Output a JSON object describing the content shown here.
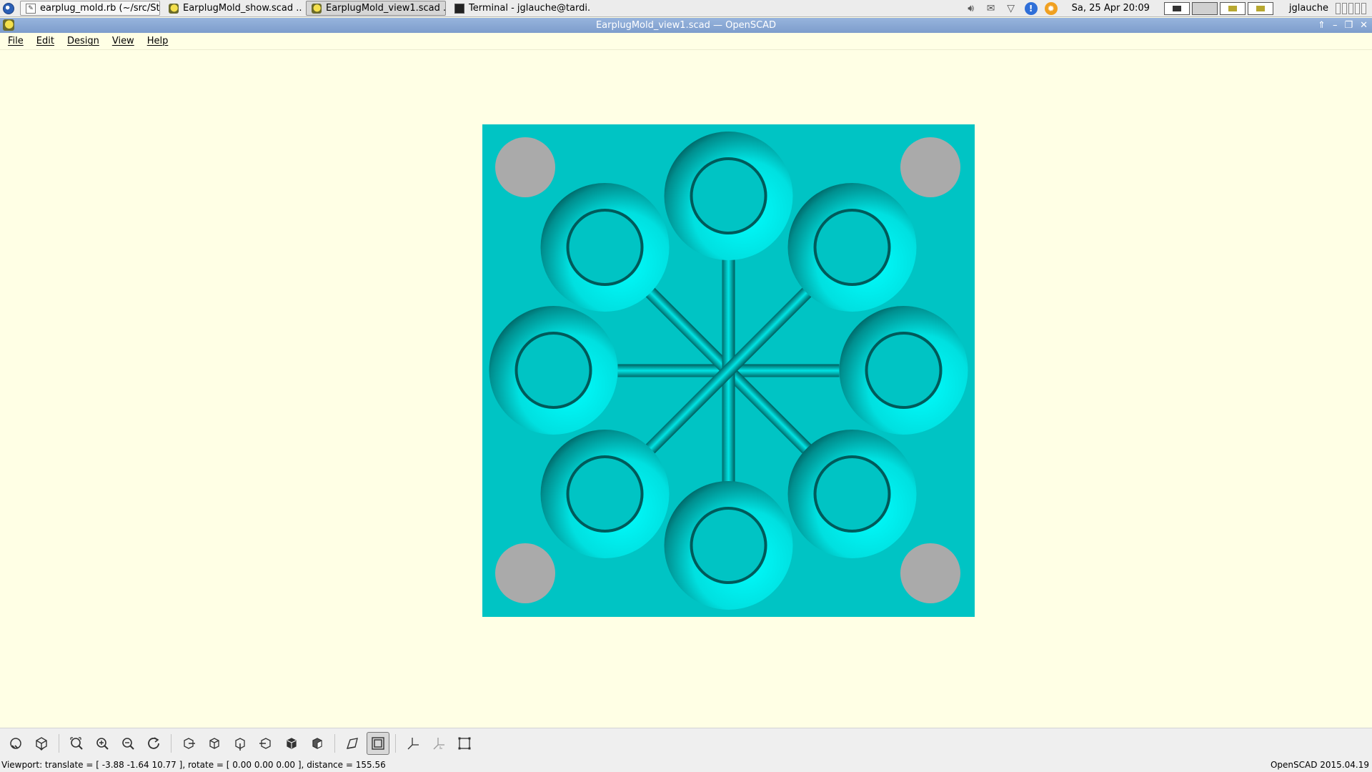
{
  "taskbar": {
    "tasks": [
      {
        "label": "earplug_mold.rb (~/src/St...",
        "icon": "text-editor-icon"
      },
      {
        "label": "EarplugMold_show.scad ...",
        "icon": "openscad-icon"
      },
      {
        "label": "EarplugMold_view1.scad ...",
        "icon": "openscad-icon"
      },
      {
        "label": "Terminal - jglauche@tardi...",
        "icon": "terminal-icon"
      }
    ],
    "clock": "Sa, 25 Apr  20:09",
    "user": "jglauche",
    "info_glyph": "!"
  },
  "window": {
    "title": "EarplugMold_view1.scad — OpenSCAD"
  },
  "menu": {
    "items": [
      "File",
      "Edit",
      "Design",
      "View",
      "Help"
    ]
  },
  "model": {
    "plate_color": "#00c4c4",
    "ring_color": "#00ffff",
    "pin_color": "#aaaaaa",
    "background_color": "#ffffe5",
    "rings": 8,
    "pins": 4
  },
  "toolbar": {
    "buttons": [
      "preview",
      "render",
      "view-all",
      "zoom-in",
      "zoom-out",
      "reset-view",
      "view-right",
      "view-top",
      "view-bottom",
      "view-left",
      "view-front",
      "view-back",
      "perspective",
      "orthogonal",
      "show-axes",
      "show-scale-markers",
      "show-edges"
    ]
  },
  "status": {
    "viewport": "Viewport: translate = [ -3.88 -1.64 10.77 ], rotate = [ 0.00 0.00 0.00 ], distance = 155.56",
    "version": "OpenSCAD 2015.04.19"
  }
}
